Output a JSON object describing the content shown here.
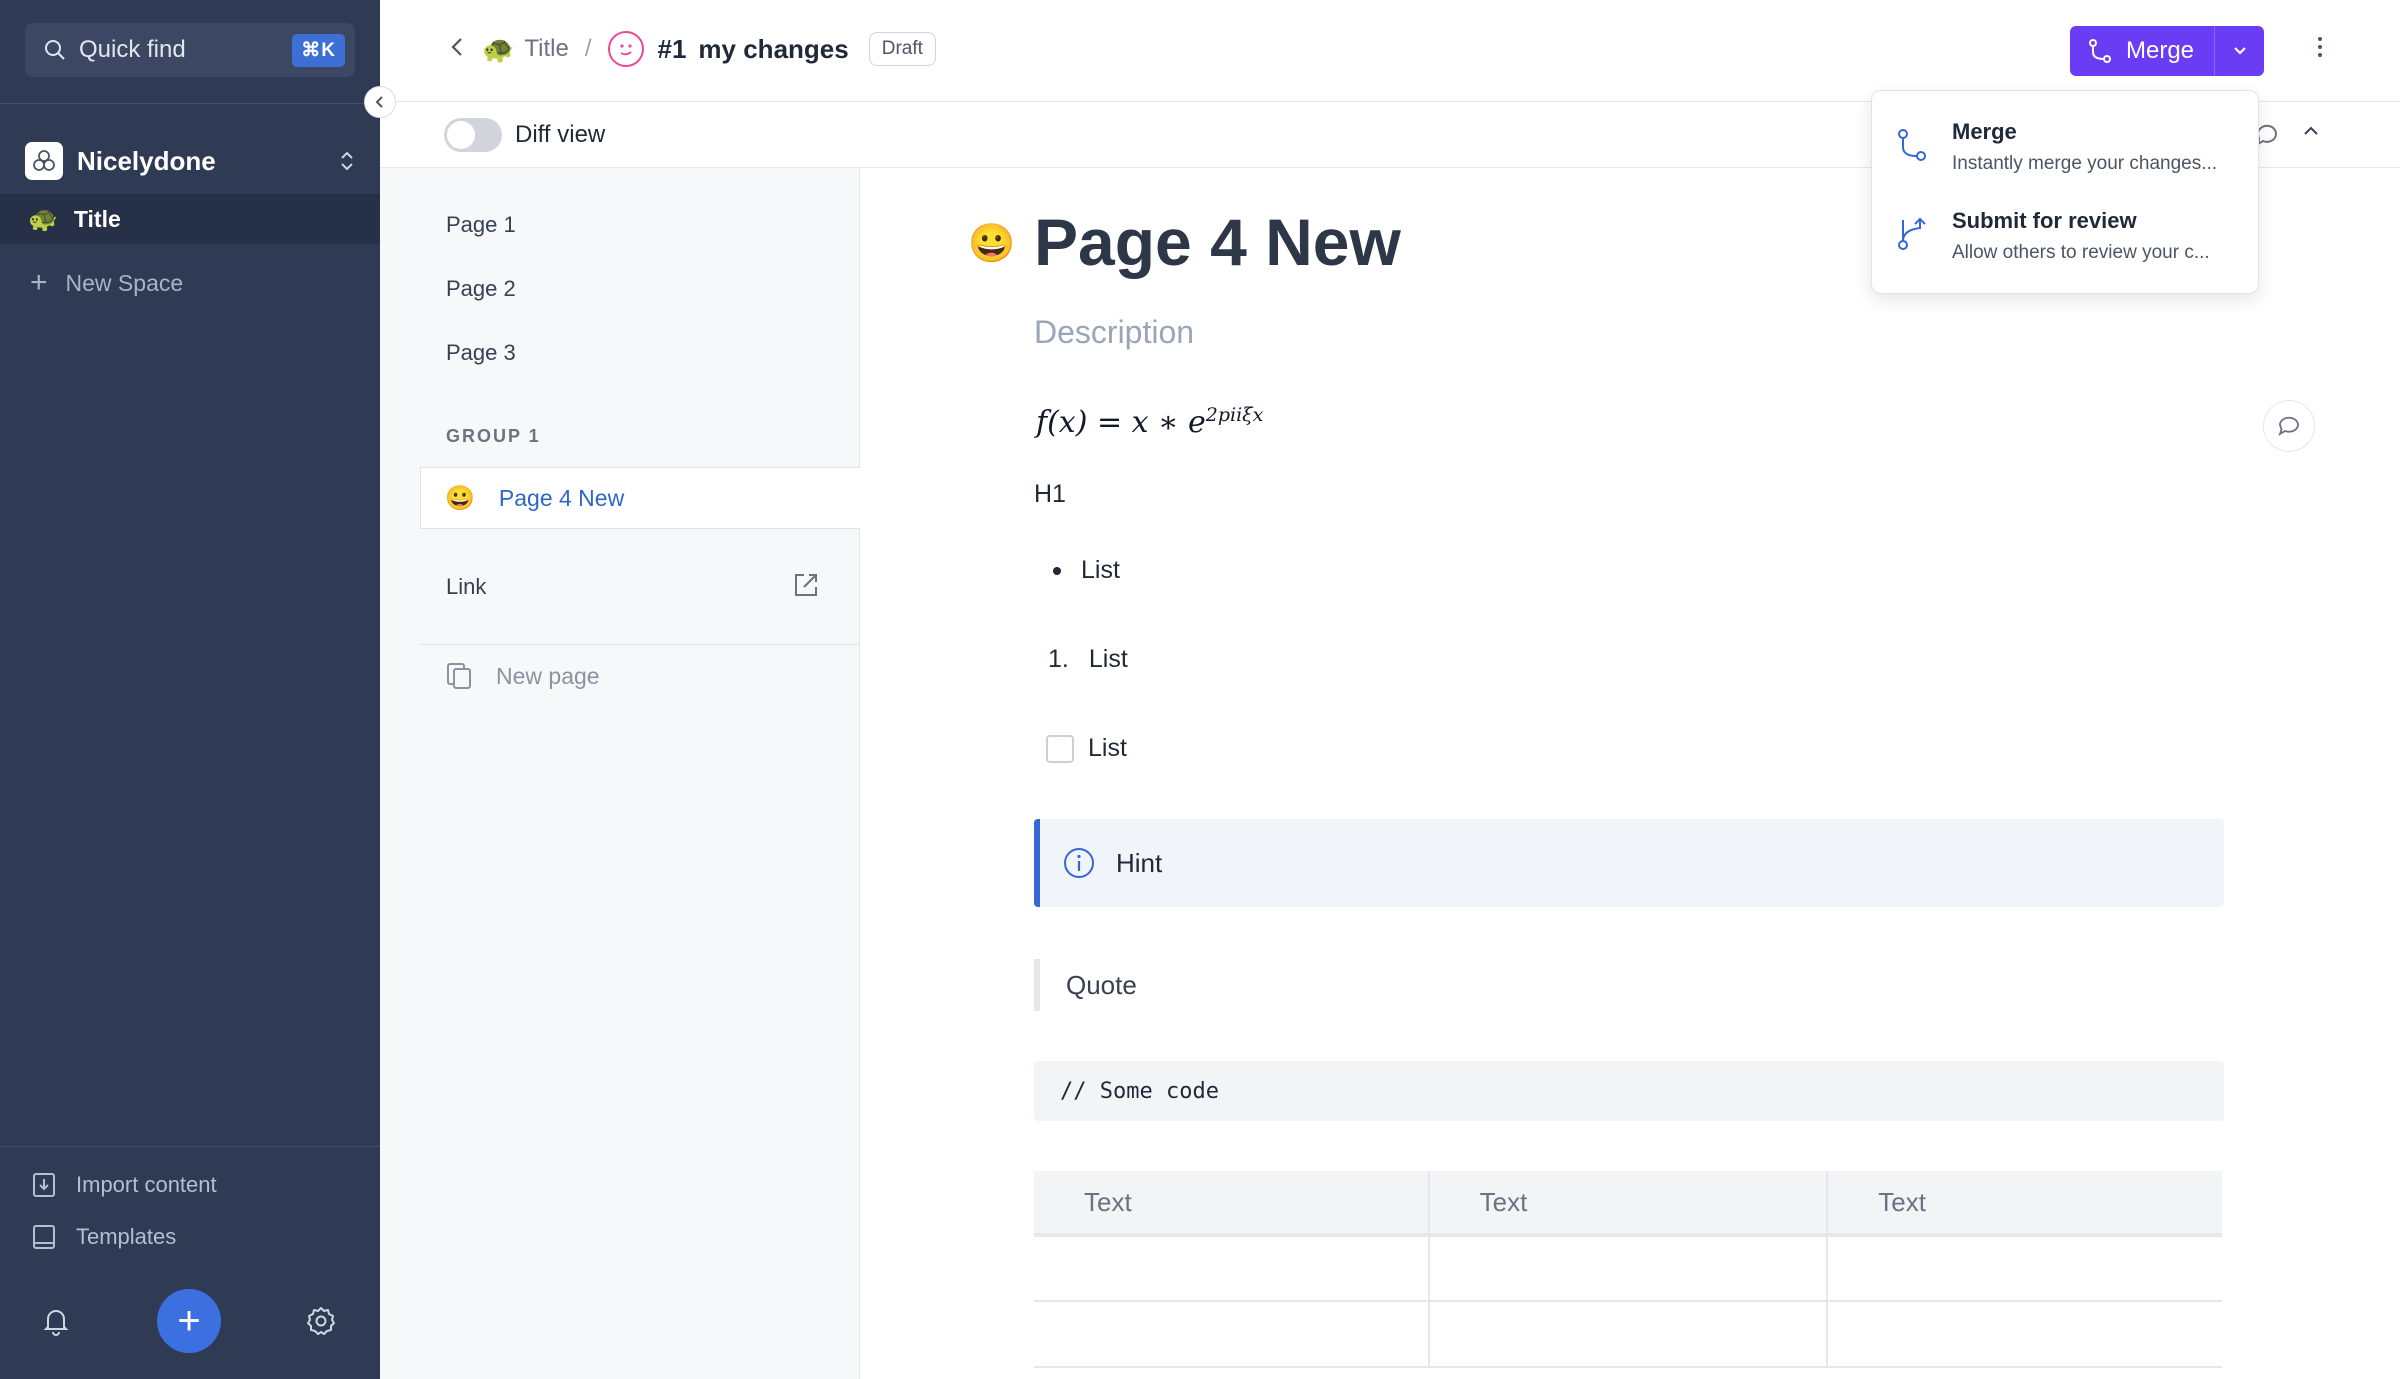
{
  "sidebar": {
    "quick_find": "Quick find",
    "shortcut": "⌘K",
    "space_name": "Nicelydone",
    "title_emoji": "🐢",
    "title_item": "Title",
    "new_space": "New Space",
    "import_content": "Import content",
    "templates": "Templates"
  },
  "topbar": {
    "breadcrumb_emoji": "🐢",
    "breadcrumb_title": "Title",
    "separator": "/",
    "change_number": "#1",
    "change_name": "my changes",
    "status_badge": "Draft",
    "merge_label": "Merge"
  },
  "subbar": {
    "diff_view_label": "Diff view"
  },
  "page_nav": {
    "pages": [
      "Page 1",
      "Page 2",
      "Page 3"
    ],
    "group_label": "GROUP 1",
    "active_emoji": "😀",
    "active_page": "Page 4 New",
    "link_label": "Link",
    "new_page": "New page"
  },
  "document": {
    "emoji": "😀",
    "title": "Page 4 New",
    "description": "Description",
    "math_base": "f(x) = x ∗ e",
    "math_exponent": "2piiξx",
    "heading": "H1",
    "bullet_item": "List",
    "numbered_index": "1.",
    "numbered_item": "List",
    "checkbox_item": "List",
    "hint": "Hint",
    "quote": "Quote",
    "code": "// Some code",
    "table_headers": [
      "Text",
      "Text",
      "Text"
    ]
  },
  "merge_menu": {
    "merge_title": "Merge",
    "merge_desc": "Instantly merge your changes...",
    "review_title": "Submit for review",
    "review_desc": "Allow others to review your c..."
  },
  "colors": {
    "sidebar_bg": "#2f3a54",
    "accent_blue": "#3c6fe0",
    "merge_purple": "#6a3df5",
    "active_link": "#2f67c9"
  }
}
